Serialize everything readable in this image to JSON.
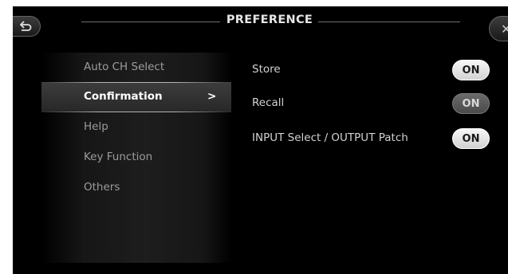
{
  "header": {
    "title": "PREFERENCE"
  },
  "sidebar": {
    "items": [
      {
        "label": "Auto CH Select"
      },
      {
        "label": "Confirmation",
        "chevron": ">"
      },
      {
        "label": "Help"
      },
      {
        "label": "Key Function"
      },
      {
        "label": "Others"
      }
    ],
    "selected": "Confirmation"
  },
  "settings": [
    {
      "label": "Store",
      "toggle": "ON",
      "state": "on"
    },
    {
      "label": "Recall",
      "toggle": "ON",
      "state": "dim"
    },
    {
      "label": "INPUT Select / OUTPUT Patch",
      "toggle": "ON",
      "state": "on"
    }
  ],
  "icons": {
    "back": "back-arrow-icon",
    "close": "close-icon"
  }
}
